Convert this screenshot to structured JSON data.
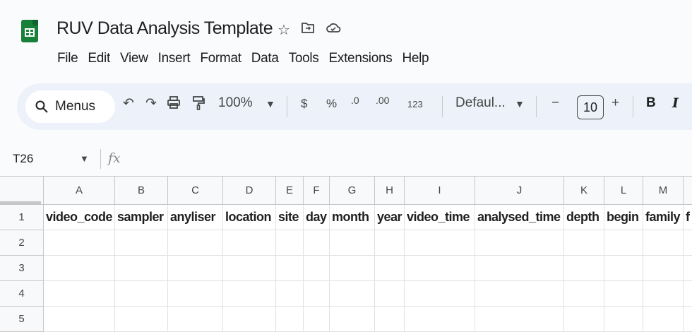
{
  "document": {
    "title": "RUV Data Analysis Template",
    "icons": [
      "star-icon",
      "move-to-folder-icon",
      "cloud-status-icon"
    ]
  },
  "menubar": [
    "File",
    "Edit",
    "View",
    "Insert",
    "Format",
    "Data",
    "Tools",
    "Extensions",
    "Help"
  ],
  "toolbar": {
    "search_label": "Menus",
    "zoom": "100%",
    "currency": "$",
    "percent": "%",
    "decrease_decimal": ".0",
    "increase_decimal": ".00",
    "number_format": "123",
    "font": "Defaul...",
    "font_size": "10",
    "minus": "−",
    "plus": "+",
    "bold": "B",
    "italic": "I"
  },
  "formula_bar": {
    "name_box": "T26",
    "fx": "fx"
  },
  "sheet": {
    "columns": [
      "A",
      "B",
      "C",
      "D",
      "E",
      "F",
      "G",
      "H",
      "I",
      "J",
      "K",
      "L",
      "M",
      ""
    ],
    "rows": [
      "1",
      "2",
      "3",
      "4",
      "5"
    ],
    "row1": [
      "video_code",
      "sampler",
      "anyliser",
      "location",
      "site",
      "day",
      "month",
      "year",
      "video_time",
      "analysed_time",
      "depth",
      "begin",
      "family",
      "f"
    ]
  }
}
